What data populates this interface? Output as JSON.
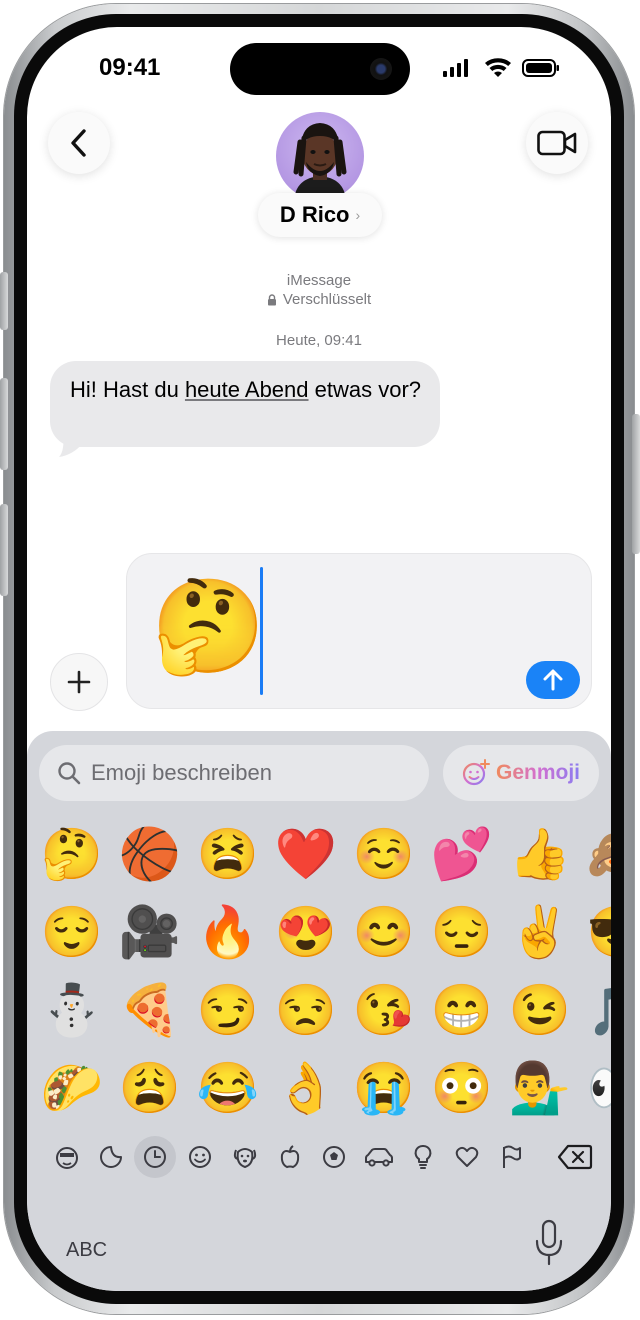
{
  "status_bar": {
    "time": "09:41"
  },
  "header": {
    "contact_name": "D Rico",
    "contact_chevron": "›",
    "service": "iMessage",
    "encryption": "Verschlüsselt",
    "timestamp": "Heute, 09:41"
  },
  "messages": [
    {
      "from": "contact",
      "pre": "Hi! Hast du ",
      "link": "heute Abend",
      "post": " etwas vor?"
    }
  ],
  "compose": {
    "content_emoji": "🤔"
  },
  "keyboard": {
    "search_placeholder": "Emoji beschreiben",
    "genmoji_label": "Genmoji",
    "emoji_rows": [
      [
        "🤔",
        "🏀",
        "😫",
        "❤️",
        "☺️",
        "💕",
        "👍",
        "🙈"
      ],
      [
        "😌",
        "🎥",
        "🔥",
        "😍",
        "😊",
        "😔",
        "✌️",
        "😎"
      ],
      [
        "⛄",
        "🍕",
        "😏",
        "😒",
        "😘",
        "😁",
        "😉",
        "🎵"
      ],
      [
        "🌮",
        "😩",
        "😂",
        "👌",
        "😭",
        "😳",
        "💁‍♂️",
        "👀"
      ]
    ],
    "categories": [
      "genmoji-icon",
      "stickers-icon",
      "recent-icon",
      "smileys-icon",
      "animals-icon",
      "food-icon",
      "activity-icon",
      "travel-icon",
      "objects-icon",
      "symbols-icon",
      "flags-icon"
    ],
    "selected_category": "recent-icon",
    "abc_label": "ABC"
  }
}
